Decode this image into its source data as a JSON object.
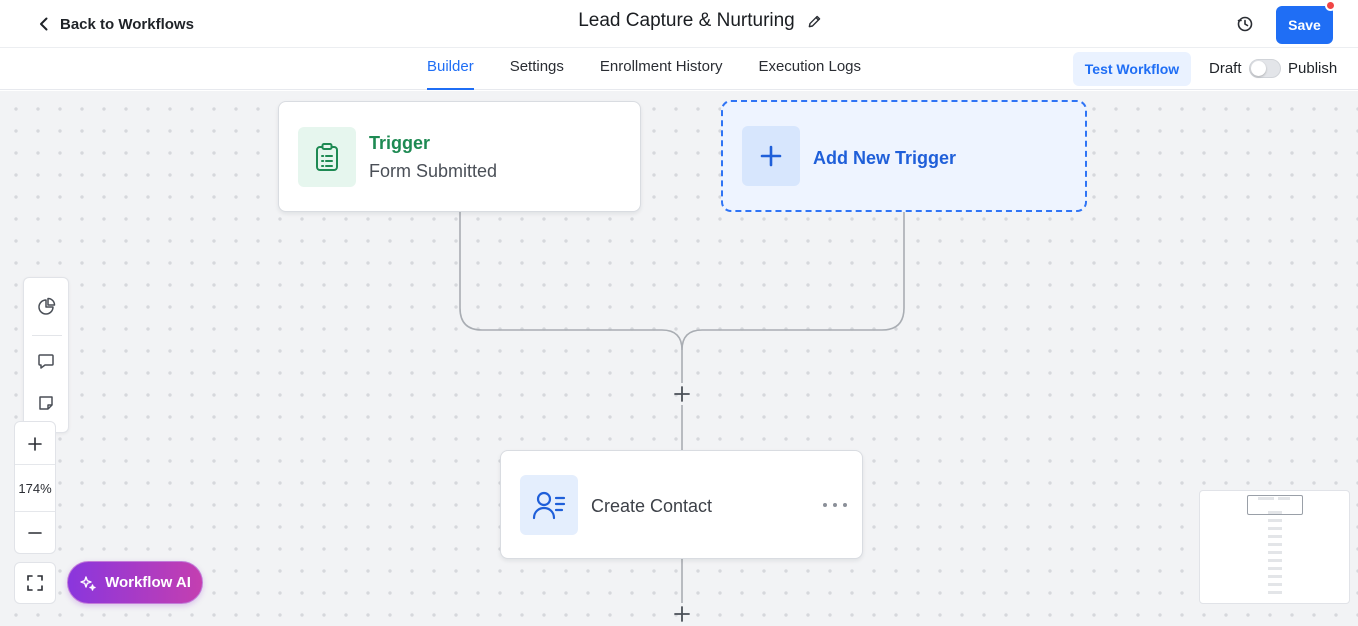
{
  "header": {
    "back_label": "Back to Workflows",
    "workflow_title": "Lead Capture & Nurturing",
    "save_label": "Save"
  },
  "tabs": [
    {
      "label": "Builder",
      "active": true
    },
    {
      "label": "Settings",
      "active": false
    },
    {
      "label": "Enrollment History",
      "active": false
    },
    {
      "label": "Execution Logs",
      "active": false
    }
  ],
  "actions": {
    "test_label": "Test Workflow",
    "draft_label": "Draft",
    "publish_label": "Publish",
    "published": false
  },
  "nodes": {
    "trigger": {
      "title": "Trigger",
      "subtitle": "Form Submitted",
      "icon": "clipboard-icon"
    },
    "add_trigger": {
      "label": "Add New Trigger",
      "icon": "plus-icon"
    },
    "action": {
      "label": "Create Contact",
      "icon": "user-list-icon"
    }
  },
  "canvas": {
    "zoom_level": "174%",
    "ai_button_label": "Workflow AI"
  },
  "colors": {
    "accent": "#1f6ef5",
    "trigger_green": "#1e8a53",
    "notification_dot": "#f04545",
    "ai_gradient_start": "#8a36dd",
    "ai_gradient_end": "#c43fb0"
  }
}
